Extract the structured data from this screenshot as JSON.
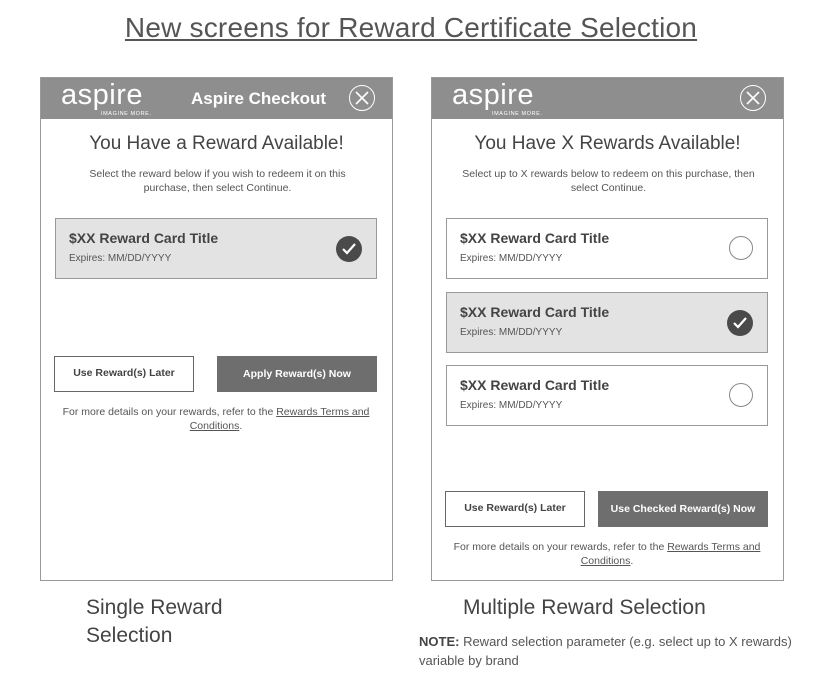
{
  "page_title": "New screens for Reward Certificate Selection",
  "logo": {
    "word": "aspire",
    "tagline": "IMAGINE MORE."
  },
  "single": {
    "header_title": "Aspire Checkout",
    "heading": "You Have a Reward Available!",
    "instructions": "Select the reward below if you wish to redeem it on this purchase, then select Continue.",
    "card": {
      "title": "$XX Reward Card Title",
      "expires": "Expires:  MM/DD/YYYY",
      "selected": true
    },
    "later_button": "Use Reward(s) Later",
    "apply_button": "Apply Reward(s) Now",
    "fine_print_prefix": "For more details on your rewards, refer to the ",
    "terms_link": "Rewards Terms and Conditions",
    "fine_print_suffix": ".",
    "caption_line1": "Single Reward",
    "caption_line2": "Selection"
  },
  "multi": {
    "heading": "You Have X Rewards Available!",
    "instructions": "Select up to X rewards below to redeem on this purchase, then select Continue.",
    "cards": [
      {
        "title": "$XX Reward Card Title",
        "expires": "Expires:  MM/DD/YYYY",
        "selected": false
      },
      {
        "title": "$XX Reward Card Title",
        "expires": "Expires:  MM/DD/YYYY",
        "selected": true
      },
      {
        "title": "$XX Reward Card Title",
        "expires": "Expires:  MM/DD/YYYY",
        "selected": false
      }
    ],
    "later_button": "Use Reward(s) Later",
    "apply_button": "Use Checked Reward(s) Now",
    "fine_print_prefix": "For more details on your rewards, refer to the ",
    "terms_link": "Rewards Terms and Conditions",
    "fine_print_suffix": ".",
    "caption": "Multiple Reward Selection"
  },
  "note": {
    "label": "NOTE:",
    "text": " Reward selection parameter (e.g. select up to X rewards) variable by brand"
  },
  "icons": {
    "close": "close-icon",
    "check": "checkmark-icon",
    "radio": "radio-empty-icon"
  },
  "colors": {
    "header": "#8e8e8e",
    "selected_card": "#e3e3e3",
    "primary_button": "#6e6e6e"
  }
}
